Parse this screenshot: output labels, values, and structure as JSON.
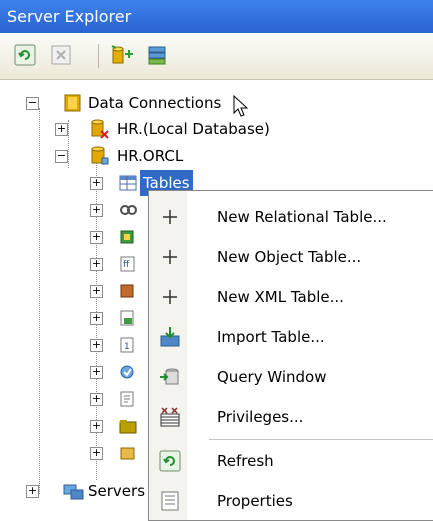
{
  "window": {
    "title": "Server Explorer"
  },
  "toolbar": {
    "buttons": [
      {
        "icon": "refresh-icon"
      },
      {
        "icon": "stop-icon"
      },
      {
        "icon": "add-connection-icon"
      },
      {
        "icon": "connect-server-icon"
      }
    ]
  },
  "tree": {
    "data_connections": "Data Connections",
    "hr_local": "HR.(Local Database)",
    "hr_orcl": "HR.ORCL",
    "tables": "Tables",
    "servers": "Servers"
  },
  "context_menu": {
    "items": [
      {
        "label": "New Relational Table...",
        "icon": "plus-icon"
      },
      {
        "label": "New Object Table...",
        "icon": "plus-icon"
      },
      {
        "label": "New XML Table...",
        "icon": "plus-icon"
      },
      {
        "label": "Import Table...",
        "icon": "import-icon"
      },
      {
        "label": "Query Window",
        "icon": "query-window-icon"
      },
      {
        "label": "Privileges...",
        "icon": "privileges-icon"
      },
      {
        "label": "Refresh",
        "icon": "refresh-icon"
      },
      {
        "label": "Properties",
        "icon": "properties-icon"
      }
    ]
  }
}
